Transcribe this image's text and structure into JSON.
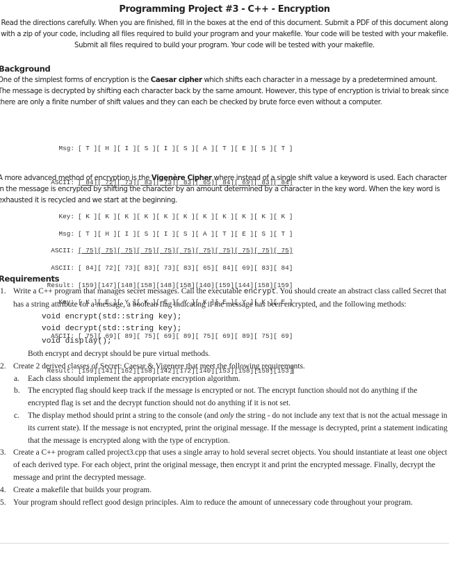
{
  "title": "Programming Project #3 - C++ - Encryption",
  "intro": "Read the directions carefully.  When you are finished, fill in the boxes at the end of this document.  Submit a PDF of this document along with a zip of your code, including all files required to build your program and your makefile.   Your code will be tested with your makefile.  Submit all files required to build your program.  Your code will be tested with your makefile.",
  "background": {
    "heading": "Background",
    "caesar_para": {
      "pre": "One of the simplest forms of encryption is the ",
      "bold": "Caesar cipher",
      "post": " which shifts each character in a message by a predetermined amount.  The message is decrypted by shifting each character back by the same amount.  However, this type of encryption is trivial to break since there are only a finite number of shift values and they can each be checked by brute force even without a computer."
    },
    "caesar_table": {
      "rows": [
        {
          "label": "Msg:",
          "cells": "[ T ][ H ][ I ][ S ][ I ][ S ][ A ][ T ][ E ][ S ][ T ]",
          "underline": false
        },
        {
          "label": "ASCII:",
          "cells": "[ 84][ 72][ 73][ 83][ 73][ 83][ 65][ 84][ 69][ 83][ 84]",
          "underline": true
        },
        {
          "label": "Key:",
          "cells": "[ K ][ K ][ K ][ K ][ K ][ K ][ K ][ K ][ K ][ K ][ K ]",
          "underline": false
        },
        {
          "label": "ASCII:",
          "cells": "[ 75][ 75][ 75][ 75][ 75][ 75][ 75][ 75][ 75][ 75][ 75]",
          "underline": true
        },
        {
          "label": "Result:",
          "cells": "[159][147][148][158][148][158][140][159][144][158][159]",
          "underline": false
        }
      ]
    },
    "vigenere_para": {
      "pre": "A more advanced method of encryption is the ",
      "bold": "Vigenère Cipher",
      "post": " where instead of a single shift value a keyword is used.  Each character in the message is encrypted by shifting the character by an amount determined by a character in the key word.  When the key word is exhausted it is recycled and we start at the beginning."
    },
    "vigenere_table": {
      "rows": [
        {
          "label": "Msg:",
          "cells": "[ T ][ H ][ I ][ S ][ I ][ S ][ A ][ T ][ E ][ S ][ T ]",
          "underline": false
        },
        {
          "label": "ASCII:",
          "cells": "[ 84][ 72][ 73][ 83][ 73][ 83][ 65][ 84][ 69][ 83][ 84]",
          "underline": false
        },
        {
          "label": "Key:",
          "cells": "[ K ][ E ][ Y ][ K ][ E ][ Y ][ K ][ E ][ Y ][ K ][ E ]",
          "underline": false
        },
        {
          "label": "ASCII:",
          "cells": "[ 75][ 69][ 89][ 75][ 69][ 89][ 75][ 69][ 89][ 75][ 69]",
          "underline": false
        },
        {
          "label": "Result:",
          "cells": "[159][141][162][158][142][172][140][153][158][158][153]",
          "underline": false
        }
      ]
    }
  },
  "requirements": {
    "heading": "Requirements",
    "item1": {
      "num": "1.",
      "pre": "Write a C++ program that manages secret messages.  Call the executable ",
      "code": "encrypt",
      "post": ".  You should create an abstract class called Secret that has a string attribute for a message, a boolean flag indicating if the message has been encrypted, and the following methods:",
      "methods": [
        "void encrypt(std::string key);",
        "void decrypt(std::string key);",
        "void display();"
      ],
      "note": "Both encrypt and decrypt should be pure virtual methods."
    },
    "item2": {
      "num": "2.",
      "text": "Create 2 derived classes of Secret: Caesar & Vigenere that meet the following requirements.",
      "subs": [
        {
          "num": "a.",
          "text": "Each class should implement the appropriate encryption algorithm."
        },
        {
          "num": "b.",
          "text": "The encrypted flag should keep track if the message is encrypted or not.  The encrypt function should not do anything if the encrypted flag is set and the decrypt function should not do anything if it is not set."
        },
        {
          "num": "c.",
          "pre": "The display method should print a string to the console (and ",
          "em": "only",
          "post": " the string - do not include any text that is not the actual message in its current state).  If the message is not encrypted, print the original message.  If the message is decrypted, print a statement indicating that the message is encrypted along with the type of encryption."
        }
      ]
    },
    "item3": {
      "num": "3.",
      "text": "Create a C++ program called project3.cpp that uses a single array to hold several secret objects.  You should instantiate at least one object of each derived type.  For each object, print the original message, then encrypt it and print the encrypted message.  Finally, decrypt the message and print the decrypted message."
    },
    "item4": {
      "num": "4.",
      "text": "Create a makefile that builds your program."
    },
    "item5": {
      "num": "5.",
      "text": "Your program should reflect good design principles.  Aim to reduce the amount of unnecessary code throughout your program."
    }
  }
}
